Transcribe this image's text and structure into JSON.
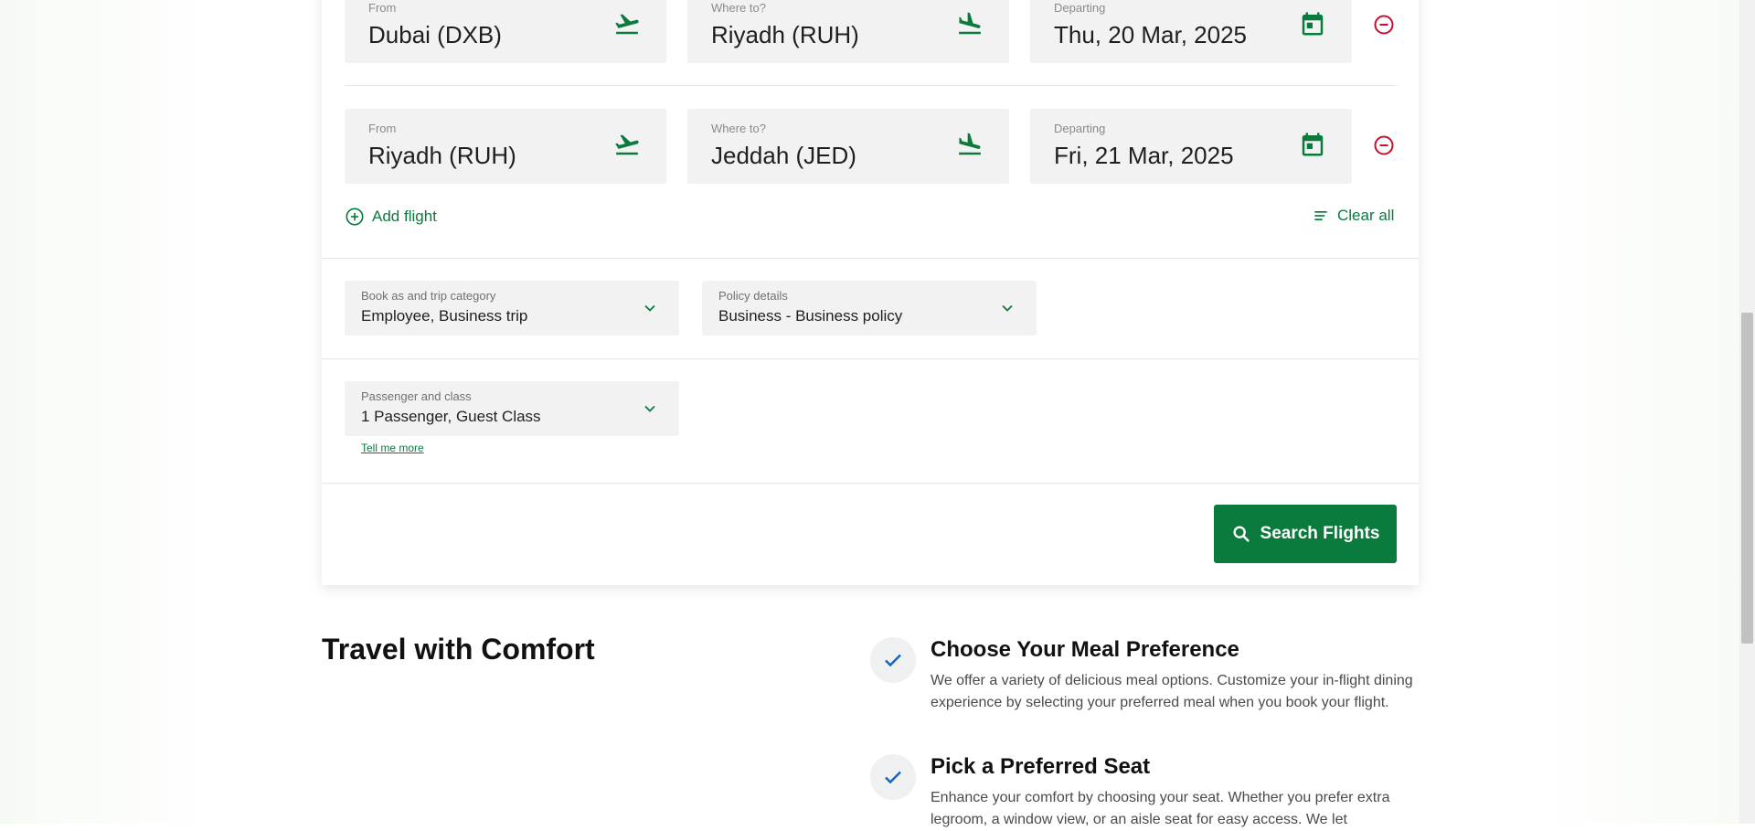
{
  "flights": [
    {
      "from_label": "From",
      "from_value": "Dubai (DXB)",
      "to_label": "Where to?",
      "to_value": "Riyadh (RUH)",
      "date_label": "Departing",
      "date_value": "Thu, 20 Mar, 2025"
    },
    {
      "from_label": "From",
      "from_value": "Riyadh (RUH)",
      "to_label": "Where to?",
      "to_value": "Jeddah (JED)",
      "date_label": "Departing",
      "date_value": "Fri, 21 Mar, 2025"
    }
  ],
  "actions": {
    "add_flight": "Add flight",
    "clear_all": "Clear all"
  },
  "booking": {
    "category_label": "Book as and trip category",
    "category_value": "Employee, Business trip",
    "policy_label": "Policy details",
    "policy_value": "Business - Business policy",
    "passenger_label": "Passenger and class",
    "passenger_value": "1 Passenger, Guest Class",
    "tell_me_more": "Tell me more"
  },
  "search": {
    "label": "Search Flights"
  },
  "comfort": {
    "title": "Travel with Comfort",
    "features": [
      {
        "title": "Choose Your Meal Preference",
        "description": "We offer a variety of delicious meal options. Customize your in-flight dining experience by selecting your preferred meal when you book your flight."
      },
      {
        "title": "Pick a Preferred Seat",
        "description": "Enhance your comfort by choosing your seat. Whether you prefer extra legroom, a window view, or an aisle seat for easy access. We let"
      }
    ]
  },
  "colors": {
    "brand_green": "#0a7a3d",
    "remove_red": "#c8102e",
    "check_blue": "#1565c0"
  },
  "icons": {
    "departure": "plane-takeoff-icon",
    "arrival": "plane-landing-icon",
    "date": "calendar-icon",
    "remove": "minus-circle-icon",
    "add": "plus-circle-icon",
    "clear": "clear-lines-icon",
    "dropdown": "chevron-down-icon",
    "search": "search-icon",
    "check": "checkmark-icon"
  }
}
